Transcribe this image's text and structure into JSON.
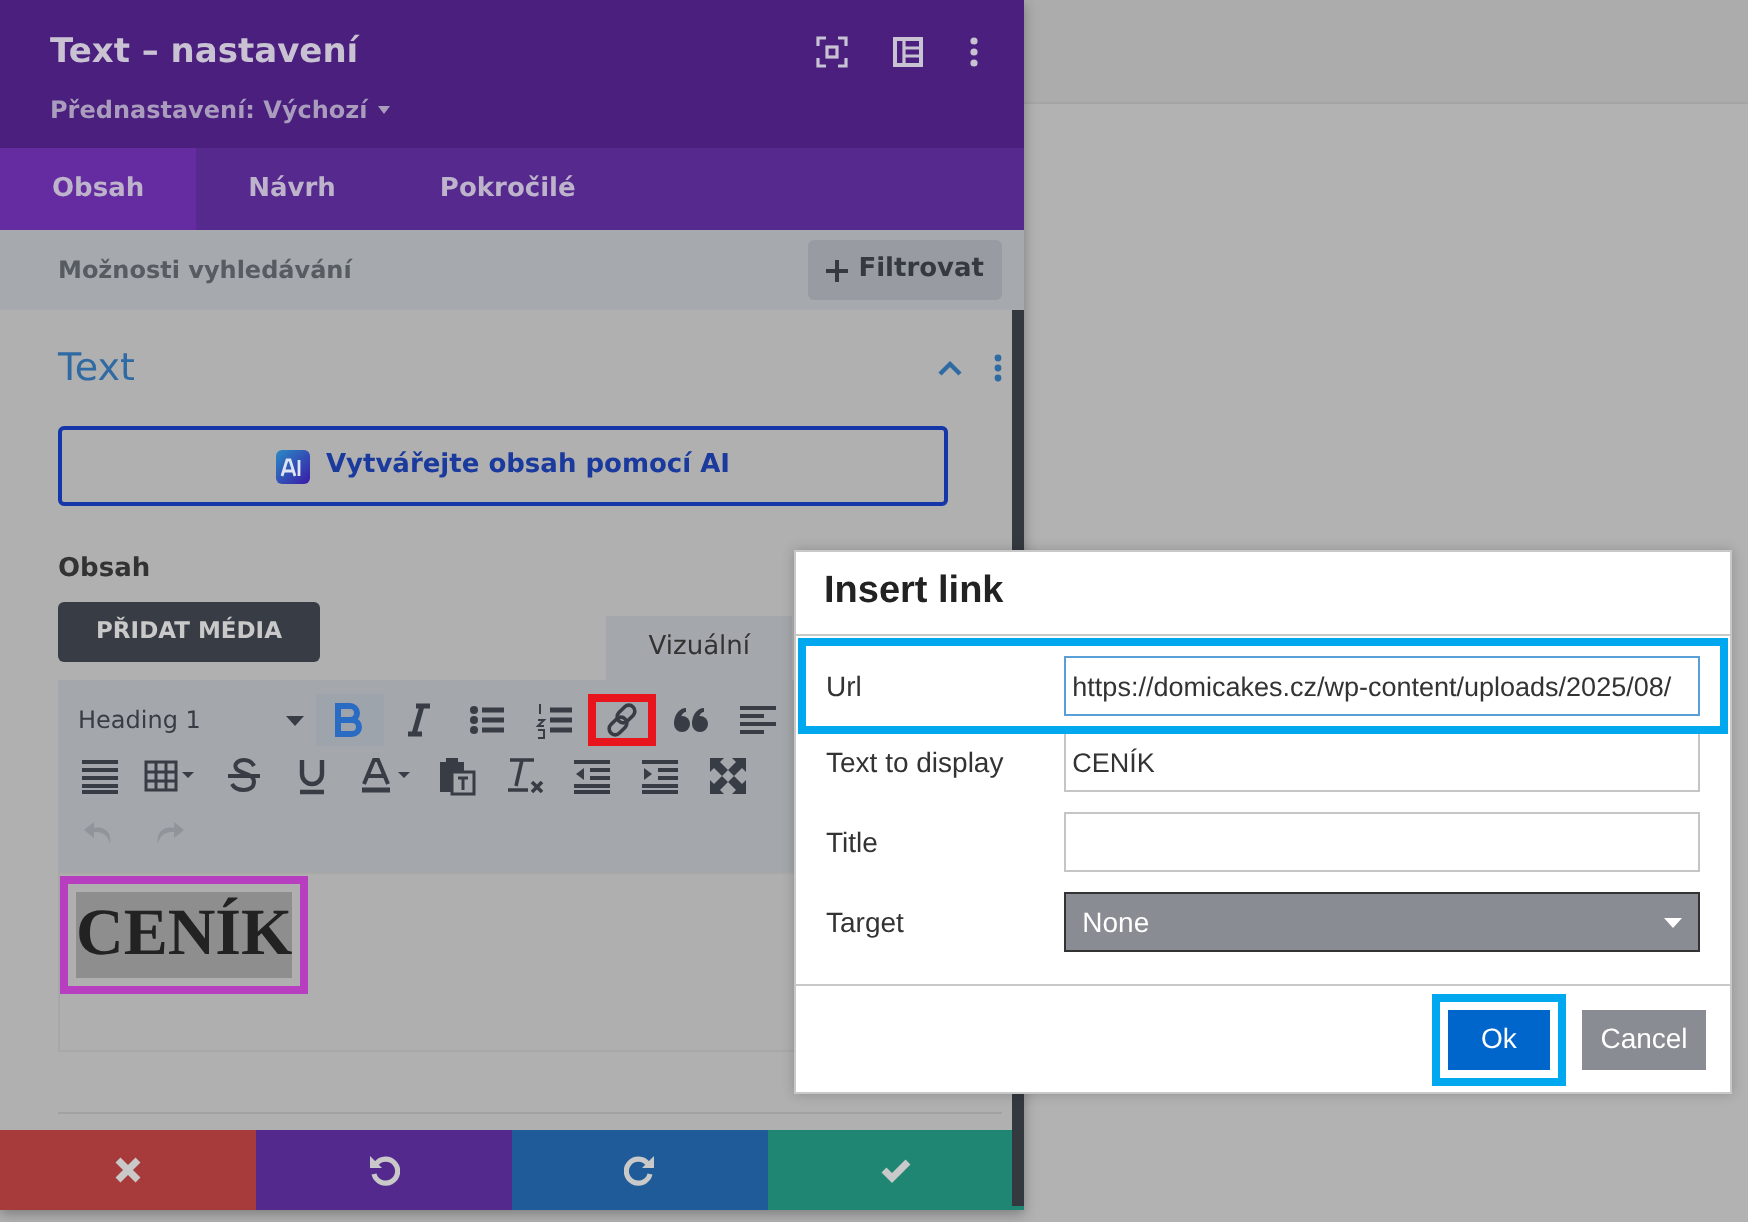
{
  "panel": {
    "title": "Text – nastavení",
    "preset": "Přednastavení: Výchozí",
    "tabs": [
      {
        "label": "Obsah",
        "selected": true
      },
      {
        "label": "Návrh",
        "selected": false
      },
      {
        "label": "Pokročilé",
        "selected": false
      }
    ],
    "search": {
      "placeholder": "Možnosti vyhledávání"
    },
    "filter_button": "Filtrovat",
    "section": {
      "title": "Text",
      "expanded": true
    },
    "ai_button": "Vytvářejte obsah pomocí AI",
    "content_label": "Obsah",
    "media_button": "PŘIDAT MÉDIA",
    "editor_tab": "Vizuální",
    "toolbar": [
      [
        {
          "kind": "format",
          "label": "Heading 1",
          "active": false,
          "highlighted": false,
          "disabled": false
        },
        {
          "kind": "bold",
          "active": true,
          "highlighted": false,
          "disabled": false
        },
        {
          "kind": "italic",
          "active": false,
          "highlighted": false,
          "disabled": false
        },
        {
          "kind": "bullets",
          "active": false,
          "highlighted": false,
          "disabled": false
        },
        {
          "kind": "numbers",
          "active": false,
          "highlighted": false,
          "disabled": false
        },
        {
          "kind": "link",
          "active": false,
          "highlighted": true,
          "disabled": false
        },
        {
          "kind": "quote",
          "active": false,
          "highlighted": false,
          "disabled": false
        },
        {
          "kind": "alignleft",
          "active": false,
          "highlighted": false,
          "disabled": false
        }
      ],
      [
        {
          "kind": "justify",
          "active": false,
          "highlighted": false,
          "disabled": false
        },
        {
          "kind": "table",
          "active": false,
          "highlighted": false,
          "disabled": false
        },
        {
          "kind": "strike",
          "active": false,
          "highlighted": false,
          "disabled": false
        },
        {
          "kind": "underline",
          "active": false,
          "highlighted": false,
          "disabled": false
        },
        {
          "kind": "color",
          "active": false,
          "highlighted": false,
          "disabled": false
        },
        {
          "kind": "paste",
          "active": false,
          "highlighted": false,
          "disabled": false
        },
        {
          "kind": "clear",
          "active": false,
          "highlighted": false,
          "disabled": false
        },
        {
          "kind": "outdent",
          "active": false,
          "highlighted": false,
          "disabled": false
        },
        {
          "kind": "indent",
          "active": false,
          "highlighted": false,
          "disabled": false
        },
        {
          "kind": "fullscreen",
          "active": false,
          "highlighted": false,
          "disabled": false
        }
      ],
      [
        {
          "kind": "undo",
          "active": false,
          "highlighted": false,
          "disabled": true
        },
        {
          "kind": "redo",
          "active": false,
          "highlighted": false,
          "disabled": true
        }
      ]
    ],
    "content": {
      "text": "CENÍK",
      "selected": true,
      "highlighted": true
    },
    "footer_buttons": [
      {
        "kind": "discard"
      },
      {
        "kind": "undo"
      },
      {
        "kind": "redo"
      },
      {
        "kind": "save"
      }
    ]
  },
  "dialog": {
    "title": "Insert link",
    "fields": [
      {
        "label": "Url",
        "kind": "text",
        "value": "https://domicakes.cz/wp-content/uploads/2025/08/",
        "focused": true,
        "highlighted": true
      },
      {
        "label": "Text to display",
        "kind": "text",
        "value": "CENÍK",
        "focused": false,
        "highlighted": false
      },
      {
        "label": "Title",
        "kind": "text",
        "focused": false,
        "highlighted": false
      },
      {
        "label": "Target",
        "kind": "select",
        "value": "None",
        "focused": false,
        "highlighted": false
      }
    ],
    "buttons": [
      {
        "label": "Ok",
        "kind": "primary",
        "highlighted": true
      },
      {
        "label": "Cancel",
        "kind": "secondary",
        "highlighted": false
      }
    ]
  }
}
